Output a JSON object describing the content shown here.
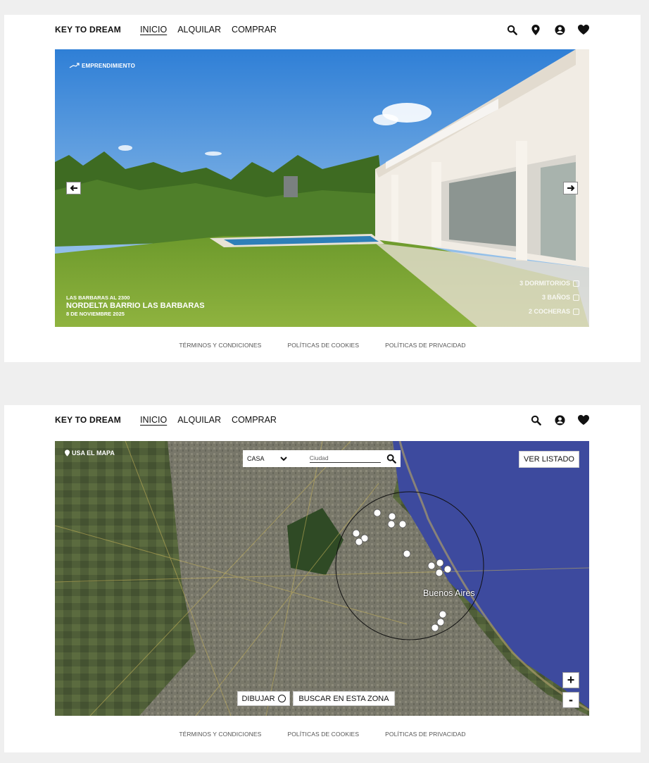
{
  "brand": "KEY TO DREAM",
  "nav": [
    "INICIO",
    "ALQUILAR",
    "COMPRAR"
  ],
  "footer": [
    "TÉRMINOS Y CONDICIONES",
    "POLÍTICAS DE COOKIES",
    "POLÍTICAS DE PRIVACIDAD"
  ],
  "hero": {
    "tag": "EMPRENDIMIENTO",
    "address": "LAS BARBARAS AL 2300",
    "title": "NORDELTA BARRIO LAS BARBARAS",
    "date": "8 DE NOVIEMBRE 2025",
    "features": [
      "3 DORMITORIOS",
      "3 BAÑOS",
      "2 COCHERAS"
    ]
  },
  "map": {
    "use_map": "USA EL MAPA",
    "property_type": "CASA",
    "city_placeholder": "Ciudad",
    "list_button": "VER LISTADO",
    "draw_button": "DIBUJAR",
    "search_zone_button": "BUSCAR EN ESTA ZONA",
    "zoom_in": "+",
    "zoom_out": "-",
    "city_label": "Buenos Aires"
  },
  "icons": {
    "header1": [
      "search-icon",
      "location-pin-icon",
      "user-icon",
      "heart-icon"
    ],
    "header2": [
      "search-icon",
      "user-icon",
      "heart-icon"
    ]
  },
  "colors": {
    "accent": "#111111",
    "background": "#efefef",
    "river": "#3d4a9e"
  }
}
